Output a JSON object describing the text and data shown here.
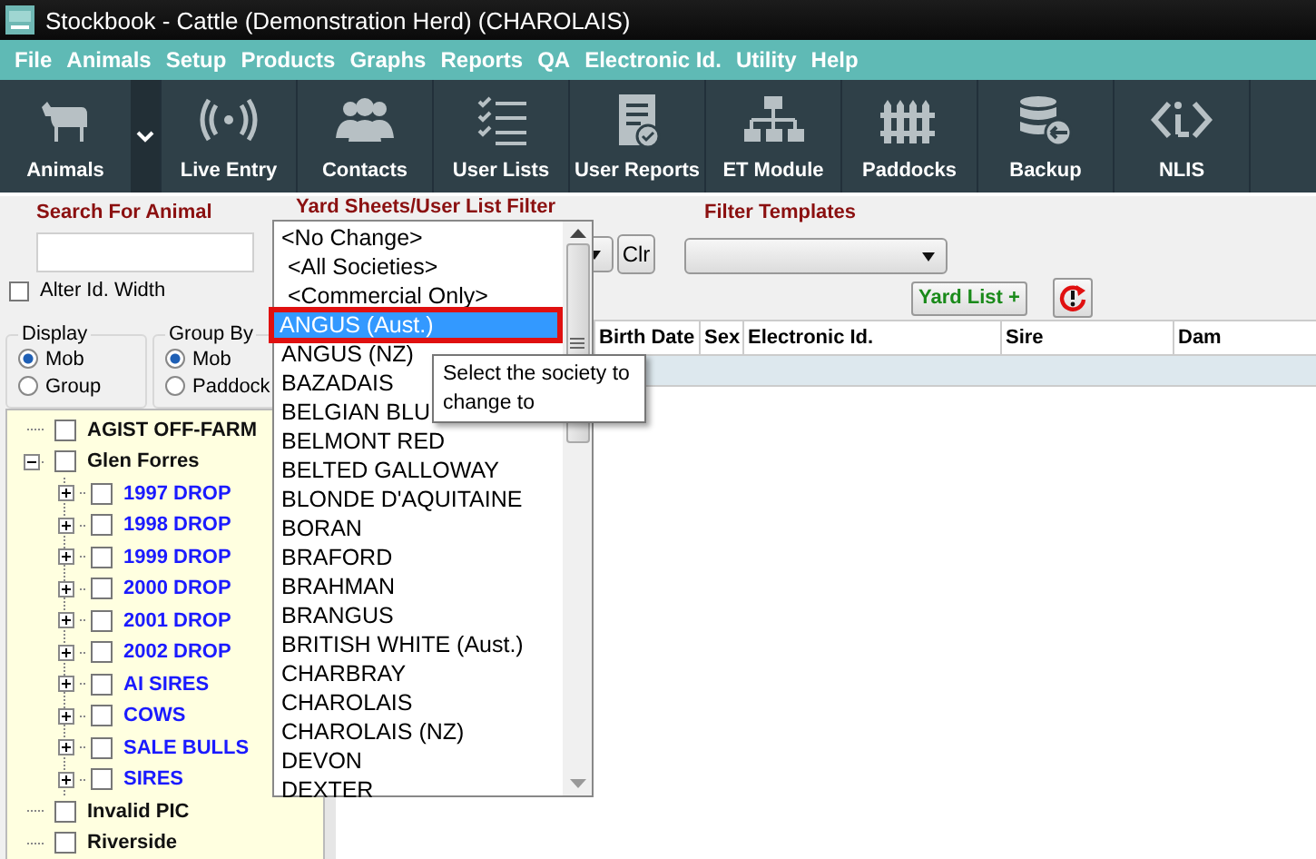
{
  "window": {
    "title": "Stockbook - Cattle (Demonstration Herd) (CHAROLAIS)"
  },
  "menu": [
    "File",
    "Animals",
    "Setup",
    "Products",
    "Graphs",
    "Reports",
    "QA",
    "Electronic Id.",
    "Utility",
    "Help"
  ],
  "toolbar": [
    {
      "label": "Animals",
      "menu": true
    },
    {
      "label": "Live Entry",
      "menu": false
    },
    {
      "label": "Contacts",
      "menu": false
    },
    {
      "label": "User Lists",
      "menu": false
    },
    {
      "label": "User Reports",
      "menu": false
    },
    {
      "label": "ET Module",
      "menu": false
    },
    {
      "label": "Paddocks",
      "menu": false
    },
    {
      "label": "Backup",
      "menu": false
    },
    {
      "label": "NLIS",
      "menu": false
    }
  ],
  "search": {
    "label": "Search For Animal"
  },
  "alter_id_width": {
    "label": "Alter Id. Width",
    "checked": false
  },
  "yard_filter": {
    "label": "Yard Sheets/User List Filter",
    "clear_button": "Clr"
  },
  "filter_templates": {
    "label": "Filter Templates"
  },
  "yard_list_button": "Yard List +",
  "display": {
    "label": "Display",
    "options": [
      {
        "label": "Mob",
        "selected": true
      },
      {
        "label": "Group",
        "selected": false
      }
    ]
  },
  "group_by": {
    "label": "Group By",
    "options": [
      {
        "label": "Mob",
        "selected": true
      },
      {
        "label": "Paddock",
        "selected": false
      }
    ]
  },
  "tree": [
    {
      "label": "AGIST OFF-FARM",
      "checked": false
    },
    {
      "label": "Glen Forres",
      "checked": false,
      "expanded": true,
      "children": [
        {
          "label": "1997 DROP",
          "checked": false,
          "expanded": false
        },
        {
          "label": "1998 DROP",
          "checked": false,
          "expanded": false
        },
        {
          "label": "1999 DROP",
          "checked": false,
          "expanded": false
        },
        {
          "label": "2000 DROP",
          "checked": false,
          "expanded": false
        },
        {
          "label": "2001 DROP",
          "checked": false,
          "expanded": false
        },
        {
          "label": "2002 DROP",
          "checked": false,
          "expanded": false
        },
        {
          "label": "AI SIRES",
          "checked": false,
          "expanded": false
        },
        {
          "label": "COWS",
          "checked": false,
          "expanded": false
        },
        {
          "label": "SALE BULLS",
          "checked": false,
          "expanded": false
        },
        {
          "label": "SIRES",
          "checked": false,
          "expanded": false
        }
      ]
    },
    {
      "label": "Invalid PIC",
      "checked": false
    },
    {
      "label": "Riverside",
      "checked": false
    }
  ],
  "table": {
    "columns": [
      "Birth Date",
      "Sex",
      "Electronic Id.",
      "Sire",
      "Dam"
    ]
  },
  "society_list": [
    {
      "label": "<No Change>",
      "selected": false
    },
    {
      "label": " <All Societies>",
      "selected": false
    },
    {
      "label": " <Commercial Only>",
      "selected": false
    },
    {
      "label": "ANGUS (Aust.)",
      "selected": true
    },
    {
      "label": "ANGUS (NZ)",
      "selected": false
    },
    {
      "label": "BAZADAIS",
      "selected": false
    },
    {
      "label": "BELGIAN BLU",
      "selected": false
    },
    {
      "label": "BELMONT RED",
      "selected": false
    },
    {
      "label": "BELTED GALLOWAY",
      "selected": false
    },
    {
      "label": "BLONDE D'AQUITAINE",
      "selected": false
    },
    {
      "label": "BORAN",
      "selected": false
    },
    {
      "label": "BRAFORD",
      "selected": false
    },
    {
      "label": "BRAHMAN",
      "selected": false
    },
    {
      "label": "BRANGUS",
      "selected": false
    },
    {
      "label": "BRITISH WHITE (Aust.)",
      "selected": false
    },
    {
      "label": "CHARBRAY",
      "selected": false
    },
    {
      "label": "CHAROLAIS",
      "selected": false
    },
    {
      "label": "CHAROLAIS (NZ)",
      "selected": false
    },
    {
      "label": "DEVON",
      "selected": false
    },
    {
      "label": "DEXTER",
      "selected": false
    }
  ],
  "tooltip": "Select the society to change to"
}
